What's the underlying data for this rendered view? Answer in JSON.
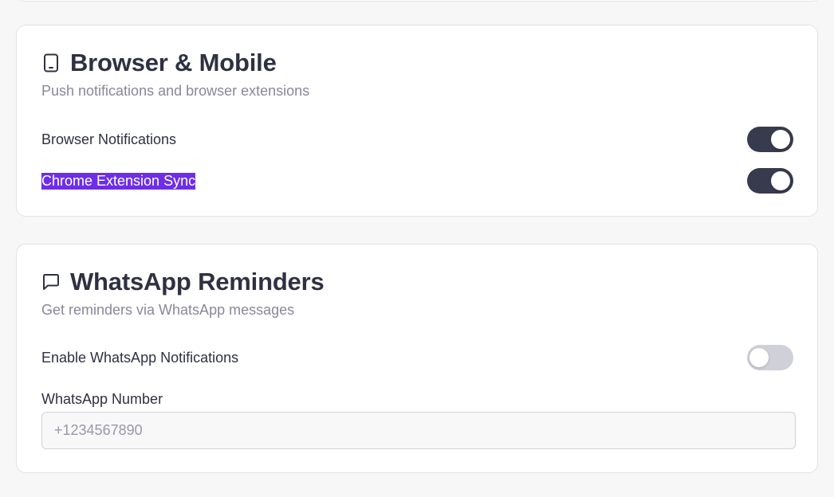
{
  "browser_section": {
    "icon": "smartphone-icon",
    "title": "Browser & Mobile",
    "subtitle": "Push notifications and browser extensions",
    "settings": [
      {
        "label": "Browser Notifications",
        "enabled": true
      },
      {
        "label": "Chrome Extension Sync",
        "enabled": true,
        "text_selected": true
      }
    ]
  },
  "whatsapp_section": {
    "icon": "message-square-icon",
    "title": "WhatsApp Reminders",
    "subtitle": "Get reminders via WhatsApp messages",
    "settings": [
      {
        "label": "Enable WhatsApp Notifications",
        "enabled": false
      }
    ],
    "number_field": {
      "label": "WhatsApp Number",
      "value": "",
      "placeholder": "+1234567890"
    }
  },
  "colors": {
    "toggle_on": "#383a4d",
    "toggle_off": "#cfd0d8",
    "selection_highlight": "#6d2ee6",
    "subtitle_text": "#8a879a"
  }
}
